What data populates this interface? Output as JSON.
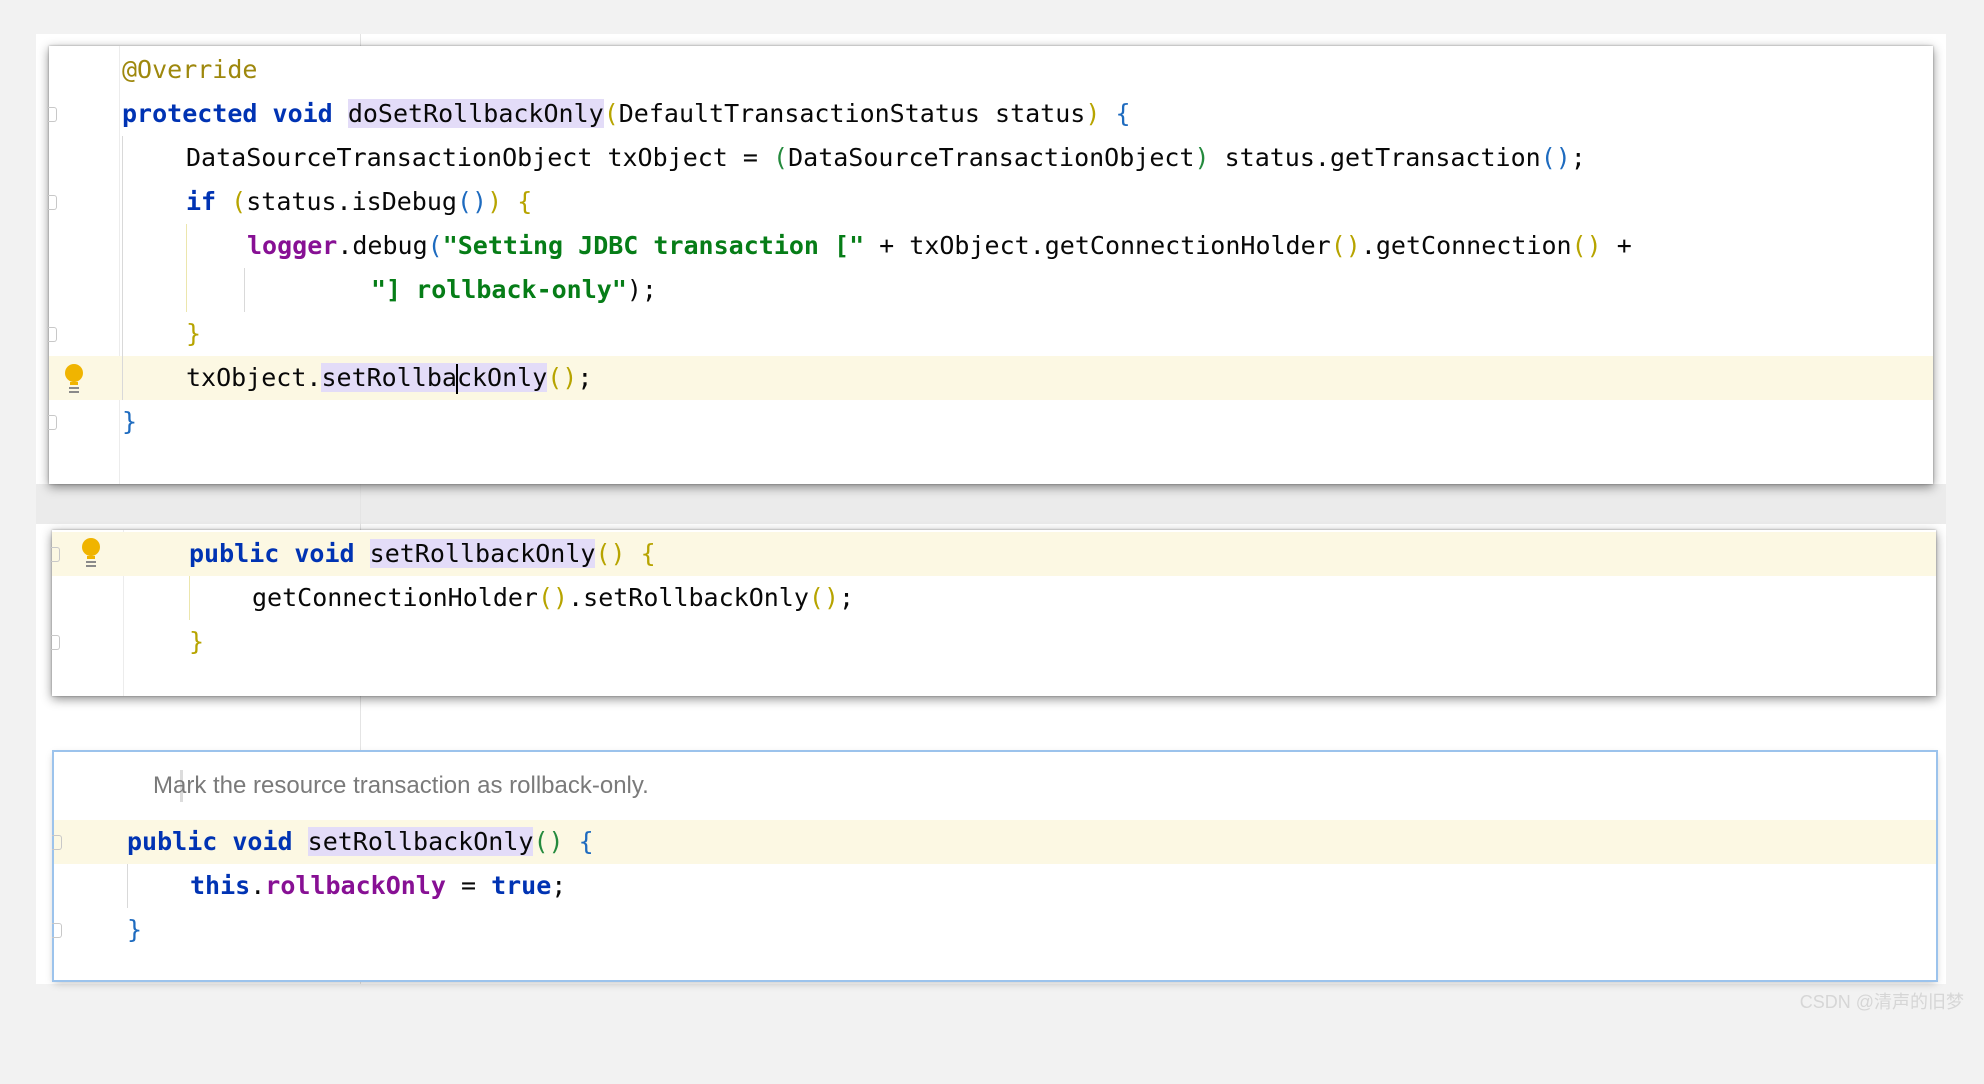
{
  "panels": {
    "top": {
      "annotation": "@Override",
      "method_signature": {
        "modifier": "protected",
        "return_type": "void",
        "name": "doSetRollbackOnly",
        "params": "DefaultTransactionStatus status"
      },
      "line_cast": {
        "type": "DataSourceTransactionObject",
        "var": "txObject",
        "assign": " = ",
        "cast_type": "DataSourceTransactionObject",
        "call": " status.getTransaction",
        "end": ";"
      },
      "line_if": {
        "kw": "if",
        "cond": "status.isDebug"
      },
      "line_logger": {
        "obj": "logger",
        "call": ".debug",
        "str1": "\"Setting JDBC transaction [\"",
        "concat": " + txObject.getConnectionHolder",
        "call2": ".getConnection",
        "plus": " +"
      },
      "line_logger2": {
        "str": "\"] rollback-only\"",
        "end": ");"
      },
      "line_set": {
        "obj": "txObject.",
        "method_pre": "setRollba",
        "method_post": "ckOnly",
        "end": ";"
      }
    },
    "middle": {
      "method_signature": {
        "modifier": "public",
        "return_type": "void",
        "name": "setRollbackOnly"
      },
      "body": {
        "call1": "getConnectionHolder",
        "call2": ".setRollbackOnly",
        "end": ";"
      }
    },
    "bottom": {
      "doc": "Mark the resource transaction as rollback-only.",
      "method_signature": {
        "modifier": "public",
        "return_type": "void",
        "name": "setRollbackOnly"
      },
      "body": {
        "this_kw": "this",
        "dot": ".",
        "field": "rollbackOnly",
        "assign": " = ",
        "value": "true",
        "end": ";"
      }
    }
  },
  "symbols": {
    "open_brace": "{",
    "close_brace": "}",
    "parens": "()",
    "open_paren": "(",
    "close_paren": ")"
  },
  "watermark": "CSDN @清声的旧梦",
  "colors": {
    "keyword": "#0033b3",
    "annotation": "#9e880d",
    "string": "#067d17",
    "field": "#871094",
    "highlight": "#e3dcf8",
    "caret_line": "#fcf8e3",
    "doc_border": "#9cc3ec"
  },
  "icons": [
    "lightbulb-icon",
    "fold-marker-icon"
  ]
}
